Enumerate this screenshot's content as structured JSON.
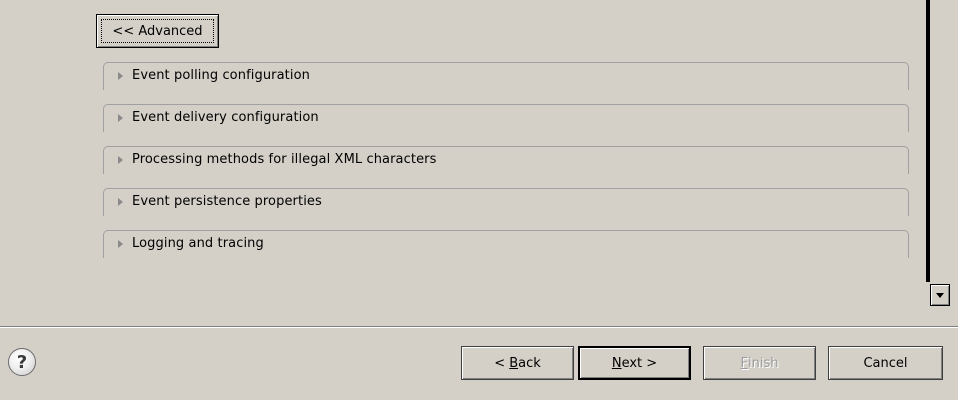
{
  "advanced_button": {
    "label": "<< Advanced"
  },
  "sections": [
    {
      "label": "Event polling configuration"
    },
    {
      "label": "Event delivery configuration"
    },
    {
      "label": "Processing methods for illegal XML characters"
    },
    {
      "label": "Event persistence properties"
    },
    {
      "label": "Logging and tracing"
    }
  ],
  "footer": {
    "help_glyph": "?",
    "back": {
      "prefix": "< ",
      "mnemonic": "B",
      "rest": "ack"
    },
    "next": {
      "mnemonic": "N",
      "rest": "ext >"
    },
    "finish": {
      "mnemonic": "F",
      "rest": "inish"
    },
    "cancel": {
      "label": "Cancel"
    }
  },
  "icons": {
    "section_toggle": "triangle-right-icon",
    "help": "question-circle-icon",
    "scroll_down": "arrow-down-icon"
  }
}
